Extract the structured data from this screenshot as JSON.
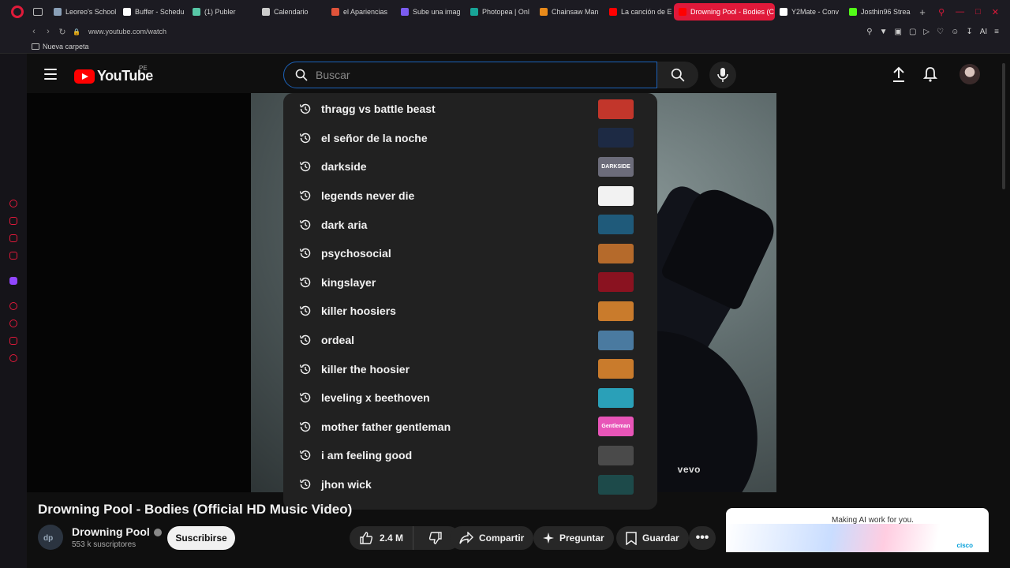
{
  "browser": {
    "tabs": [
      {
        "label": "Leoreo's School",
        "color": "#8aa0b8"
      },
      {
        "label": "Buffer - Schedu",
        "color": "#ffffff"
      },
      {
        "label": "(1) Publer",
        "color": "#57c7a6"
      },
      {
        "label": "Calendario",
        "color": "#cccccc"
      },
      {
        "label": "el Apariencias",
        "color": "#e0533a"
      },
      {
        "label": "Sube una imag",
        "color": "#7b5cf0"
      },
      {
        "label": "Photopea | Onl",
        "color": "#18a497"
      },
      {
        "label": "Chainsaw Man",
        "color": "#e88a1a"
      },
      {
        "label": "La canción de E",
        "color": "#ff0000"
      },
      {
        "label": "Drowning Pool - Bodies (C",
        "color": "#ff0000"
      },
      {
        "label": "Y2Mate - Conv",
        "color": "#ffffff"
      },
      {
        "label": "Josthin96 Strea",
        "color": "#53fc18"
      }
    ],
    "active_tab_index": 9,
    "url": "www.youtube.com/watch",
    "bookmark": "Nueva carpeta",
    "ai_label": "AI"
  },
  "youtube": {
    "logo_text": "YouTube",
    "country_code": "PE",
    "search_placeholder": "Buscar",
    "suggestions": [
      {
        "text": "thragg vs battle beast",
        "thumb": "#c2362b"
      },
      {
        "text": "el señor de la noche",
        "thumb": "#1d2a44"
      },
      {
        "text": "darkside",
        "thumb": "#6c6c7a",
        "thumb_text": "DARKSIDE"
      },
      {
        "text": "legends never die",
        "thumb": "#f2f2f2"
      },
      {
        "text": "dark aria",
        "thumb": "#1f5a7a"
      },
      {
        "text": "psychosocial",
        "thumb": "#b56a2b"
      },
      {
        "text": "kingslayer",
        "thumb": "#8a1220"
      },
      {
        "text": "killer hoosiers",
        "thumb": "#c97b2c"
      },
      {
        "text": "ordeal",
        "thumb": "#4a7aa0"
      },
      {
        "text": "killer the hoosier",
        "thumb": "#c97b2c"
      },
      {
        "text": "leveling x beethoven",
        "thumb": "#2aa0b8"
      },
      {
        "text": "mother father gentleman",
        "thumb": "#e855b8",
        "thumb_text": "Gentleman"
      },
      {
        "text": "i am feeling good",
        "thumb": "#4a4a4a"
      },
      {
        "text": "jhon wick",
        "thumb": "#1d4a4a"
      }
    ],
    "video": {
      "title": "Drowning Pool - Bodies (Official HD Music Video)",
      "watermark": "vevo",
      "channel": "Drowning Pool",
      "subscribers": "553 k suscriptores",
      "subscribe_label": "Suscribirse",
      "likes": "2.4 M",
      "share_label": "Compartir",
      "ask_label": "Preguntar",
      "save_label": "Guardar",
      "more_label": "•••"
    },
    "ad": {
      "text": "Making AI work for you.",
      "brand": "cisco"
    }
  }
}
